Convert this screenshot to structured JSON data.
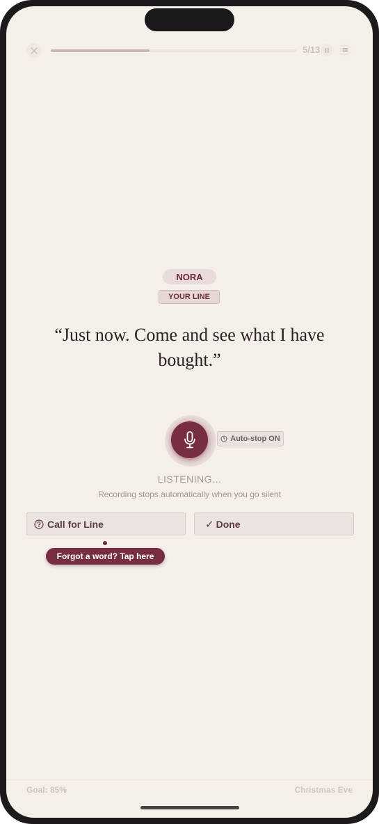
{
  "progress": {
    "counter": "5/13",
    "fraction": 0.4
  },
  "character": {
    "name": "NORA",
    "badge": "YOUR LINE"
  },
  "line": {
    "text": "“Just now. Come and see what I have bought.”"
  },
  "recording": {
    "autostop_label": "Auto-stop ON",
    "status": "LISTENING...",
    "hint": "Recording stops automatically when you go silent"
  },
  "actions": {
    "call_label": "Call for Line",
    "done_label": "Done",
    "tooltip": "Forgot a word? Tap here"
  },
  "footer": {
    "goal": "Goal: 85%",
    "scene": "Christmas Eve"
  },
  "colors": {
    "accent": "#772d42",
    "background": "#f4efe9"
  },
  "icons": {
    "close": "close-icon",
    "pause": "pause-icon",
    "menu": "menu-icon",
    "mic": "microphone-icon",
    "timer": "timer-icon",
    "help": "question-circle-icon",
    "check": "checkmark-icon"
  }
}
